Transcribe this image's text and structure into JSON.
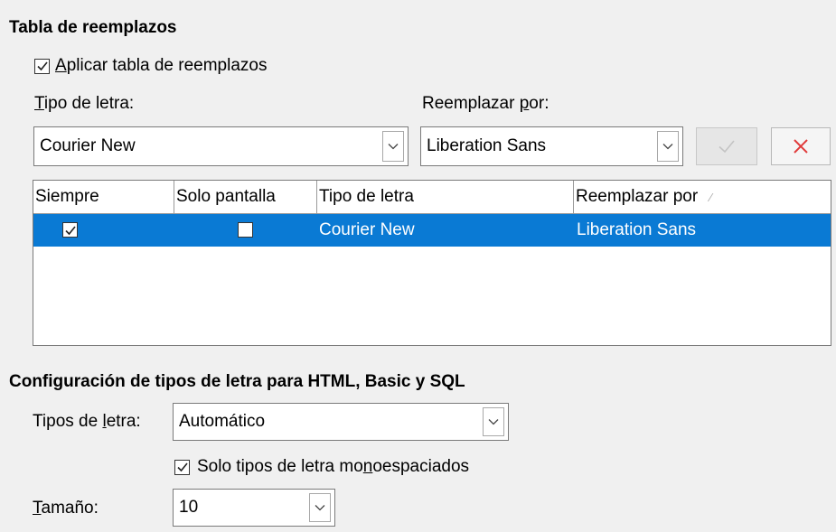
{
  "replacement": {
    "title": "Tabla de reemplazos",
    "apply_checkbox": {
      "label_first": "A",
      "label_rest": "plicar tabla de reemplazos",
      "checked": true
    },
    "font_label": {
      "first": "T",
      "rest": "ipo de letra:"
    },
    "replace_label": {
      "before": "Reemplazar ",
      "u": "p",
      "after": "or:"
    },
    "font_value": "Courier New",
    "replace_value": "Liberation Sans",
    "apply_icon": "checkmark-icon",
    "delete_icon": "close-icon",
    "delete_color": "#e03a3a",
    "table": {
      "headers": [
        "Siempre",
        "Solo pantalla",
        "Tipo de letra",
        "Reemplazar por"
      ],
      "sort_indicator": "⁄",
      "rows": [
        {
          "always": true,
          "screen_only": false,
          "font": "Courier New",
          "replace": "Liberation Sans",
          "selected": true
        }
      ],
      "selection_color": "#0a7ad4"
    }
  },
  "html_fonts": {
    "title": "Configuración de tipos de letra para HTML, Basic y SQL",
    "fonts_label": {
      "before": "Tipos de ",
      "u": "l",
      "after": "etra:"
    },
    "fonts_value": "Automático",
    "mono_checkbox": {
      "before": "Solo tipos de letra mo",
      "u": "n",
      "after": "oespaciados",
      "checked": true
    },
    "size_label": {
      "first": "T",
      "rest": "amaño:"
    },
    "size_value": "10"
  }
}
